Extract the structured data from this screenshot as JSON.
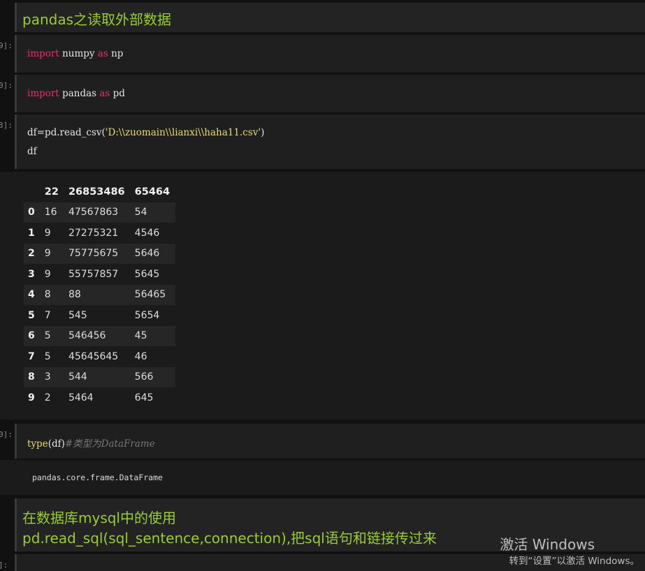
{
  "cells": {
    "md1": {
      "text": "pandas之读取外部数据"
    },
    "c1": {
      "prompt": "9]:",
      "tokens": [
        "import",
        " numpy ",
        "as",
        " np"
      ]
    },
    "c2": {
      "prompt": "0]:",
      "tokens": [
        "import",
        " pandas ",
        "as",
        " pd"
      ]
    },
    "c3": {
      "prompt": "3]:",
      "line1_pre": "df=pd.read_csv(",
      "line1_str": "'D:\\\\zuomain\\\\lianxi\\\\haha11.csv'",
      "line1_post": ")",
      "line2": "df"
    },
    "table": {
      "columns": [
        "",
        "22",
        "26853486",
        "65464"
      ],
      "rows": [
        [
          "0",
          "16",
          "47567863",
          "54"
        ],
        [
          "1",
          "9",
          "27275321",
          "4546"
        ],
        [
          "2",
          "9",
          "75775675",
          "5646"
        ],
        [
          "3",
          "9",
          "55757857",
          "5645"
        ],
        [
          "4",
          "8",
          "88",
          "56465"
        ],
        [
          "5",
          "7",
          "545",
          "5654"
        ],
        [
          "6",
          "5",
          "546456",
          "45"
        ],
        [
          "7",
          "5",
          "45645645",
          "46"
        ],
        [
          "8",
          "3",
          "544",
          "566"
        ],
        [
          "9",
          "2",
          "5464",
          "645"
        ]
      ]
    },
    "c4": {
      "prompt": "0]:",
      "fn": "type",
      "args": "(df)",
      "comment": "#类型为DataFrame",
      "output": "pandas.core.frame.DataFrame"
    },
    "md2": {
      "line1": "在数据库mysql中的使用",
      "line2": "pd.read_sql(sql_sentence,connection),把sql语句和链接传过来"
    },
    "c5": {
      "prompt": "]:"
    }
  },
  "watermark": {
    "title": "激活 Windows",
    "subtitle": "转到“设置”以激活 Windows。"
  },
  "colors": {
    "markdown_text": "#9acd32",
    "keyword": "#f92672",
    "builtin": "#e6db74",
    "background": "#111111"
  }
}
